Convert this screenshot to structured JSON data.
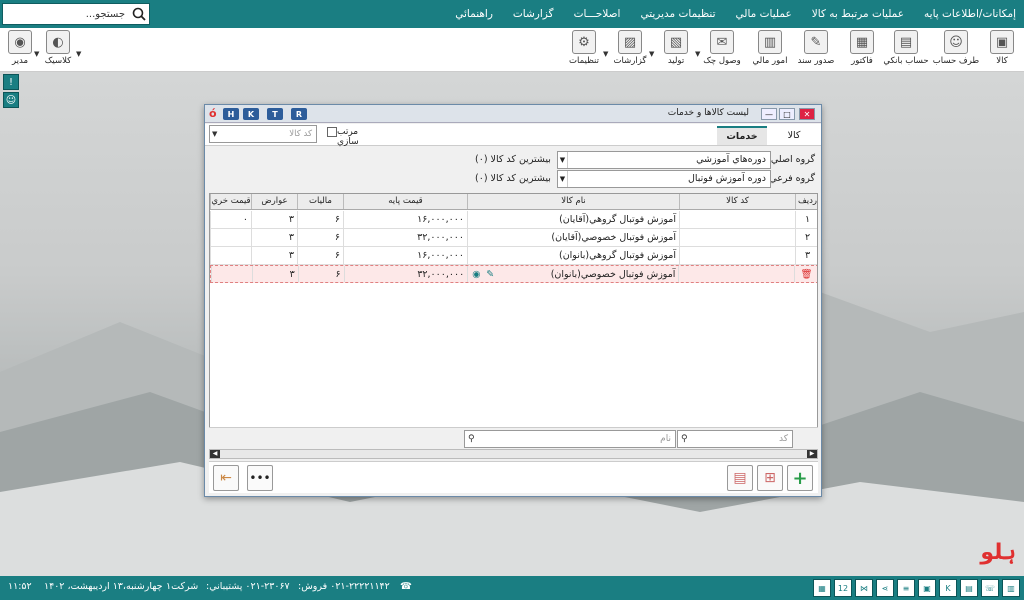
{
  "menu": {
    "items": [
      "إمكانات/اطلاعات پايه",
      "عمليات مرتبط به کالا",
      "عمليات مالي",
      "تنظيمات مديريتي",
      "اصلاحـــات",
      "گزارشات",
      "راهنمائي"
    ]
  },
  "search": {
    "placeholder": "جستجو..."
  },
  "toolbar": {
    "items": [
      {
        "label": "کالا",
        "icon": "box-icon"
      },
      {
        "label": "طرف حساب",
        "icon": "person-icon"
      },
      {
        "label": "حساب بانکي",
        "icon": "bank-icon"
      },
      {
        "label": "فاکتور",
        "icon": "invoice-icon"
      },
      {
        "label": "صدور سند",
        "icon": "document-icon"
      },
      {
        "label": "امور مالي",
        "icon": "finance-icon"
      },
      {
        "label": "وصول چک",
        "icon": "check-icon"
      },
      {
        "label": "توليد",
        "icon": "production-icon"
      },
      {
        "label": "گزارشات",
        "icon": "report-icon"
      },
      {
        "label": "تنظيمات",
        "icon": "gear-icon"
      }
    ],
    "left_items": [
      {
        "label": "کلاسيک",
        "icon": "classic-icon"
      },
      {
        "label": "مدير",
        "icon": "user-icon"
      }
    ]
  },
  "window": {
    "title": "ليست کالاها و خدمات",
    "hkt": [
      "H",
      "K",
      "T",
      "R"
    ],
    "tabs": [
      "کالا",
      "خدمات"
    ],
    "sort_label": "مرتب سازي",
    "sort_placeholder": "کد کالا",
    "main_group_label": "گروه اصلي",
    "main_group_value": "دوره‌هاي آموزشي",
    "main_group_max": "بيشترين کد کالا (۰)",
    "sub_group_label": "گروه فرعي",
    "sub_group_value": "دوره آموزش فوتبال",
    "sub_group_max": "بيشترين کد کالا (۰)",
    "columns": [
      "رديف",
      "کد کالا",
      "نام کالا",
      "قيمت پايه",
      "ماليات",
      "عوارض",
      "قيمت خري"
    ],
    "rows": [
      {
        "rad": "۱",
        "code": "",
        "name": "آموزش فوتبال گروهي(آقايان)",
        "price": "۱۶,۰۰۰,۰۰۰",
        "tax": "۶",
        "duty": "۳",
        "buy": "۰"
      },
      {
        "rad": "۲",
        "code": "",
        "name": "آموزش فوتبال خصوصي(آقايان)",
        "price": "۳۲,۰۰۰,۰۰۰",
        "tax": "۶",
        "duty": "۳",
        "buy": ""
      },
      {
        "rad": "۳",
        "code": "",
        "name": "آموزش فوتبال گروهي(بانوان)",
        "price": "۱۶,۰۰۰,۰۰۰",
        "tax": "۶",
        "duty": "۳",
        "buy": ""
      },
      {
        "rad": "",
        "code": "",
        "name": "آموزش فوتبال خصوصي(بانوان)",
        "price": "۳۲,۰۰۰,۰۰۰",
        "tax": "۶",
        "duty": "۳",
        "buy": ""
      }
    ],
    "filter_code": "کد",
    "filter_name": "نام"
  },
  "status": {
    "time": "۱۱:۵۲",
    "date": "چهارشنبه،۱۳ ارديبهشت، ۱۴۰۲",
    "company": "شرکت۱",
    "support": "۰۲۱-۲۳۰۶۷ پشتيباني:",
    "sales": "۰۲۱-۲۲۲۲۱۱۴۲ فروش:"
  },
  "logo": {
    "text": "ہلو"
  },
  "colors": {
    "accent": "#1a7e82",
    "hkt": "#2d5d9a",
    "selected_row": "#fde8e8"
  }
}
